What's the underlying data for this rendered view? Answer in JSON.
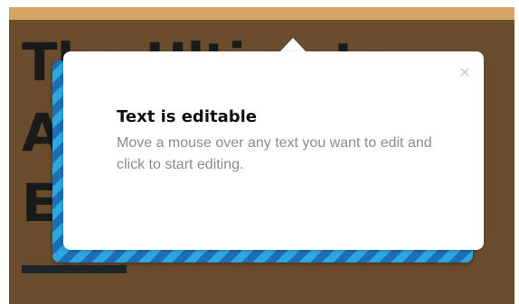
{
  "background": {
    "heading": "The Ultimate\nA\nE",
    "accent_color": "#d4a463",
    "overlay_color": "#6a4d2d"
  },
  "popover": {
    "title": "Text is editable",
    "body": "Move a mouse over any text you want to edit and click to start editing.",
    "close_icon": "close-icon",
    "stripe_colors": [
      "#1e6fb1",
      "#2fa6e0"
    ]
  }
}
